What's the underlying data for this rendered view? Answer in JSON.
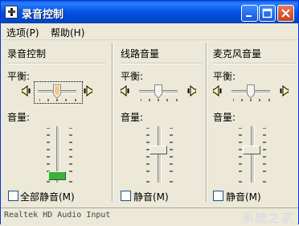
{
  "window": {
    "title": "录音控制"
  },
  "menu": [
    {
      "label": "选项(P)"
    },
    {
      "label": "帮助(H)"
    }
  ],
  "columns": [
    {
      "title": "录音控制",
      "balance_label": "平衡:",
      "volume_label": "音量:",
      "checkbox_label": "全部静音(M)",
      "checked": false,
      "balance": 0.5,
      "volume": 0.05,
      "focused": true
    },
    {
      "title": "线路音量",
      "balance_label": "平衡:",
      "volume_label": "音量:",
      "checkbox_label": "静音(M)",
      "checked": false,
      "balance": 0.5,
      "volume": 0.6,
      "focused": false
    },
    {
      "title": "麦克风音量",
      "balance_label": "平衡:",
      "volume_label": "音量:",
      "checkbox_label": "静音(M)",
      "checked": false,
      "balance": 0.5,
      "volume": 0.6,
      "focused": false
    }
  ],
  "status": {
    "device": "Realtek HD Audio Input",
    "watermark": "系统之家"
  },
  "colors": {
    "title_bar": "#0054e3",
    "close_button": "#c8421c",
    "active_thumb": "#3fae3f"
  },
  "icons": [
    "app-icon",
    "minimize-icon",
    "maximize-icon",
    "close-icon",
    "speaker-left-icon",
    "speaker-right-icon"
  ]
}
